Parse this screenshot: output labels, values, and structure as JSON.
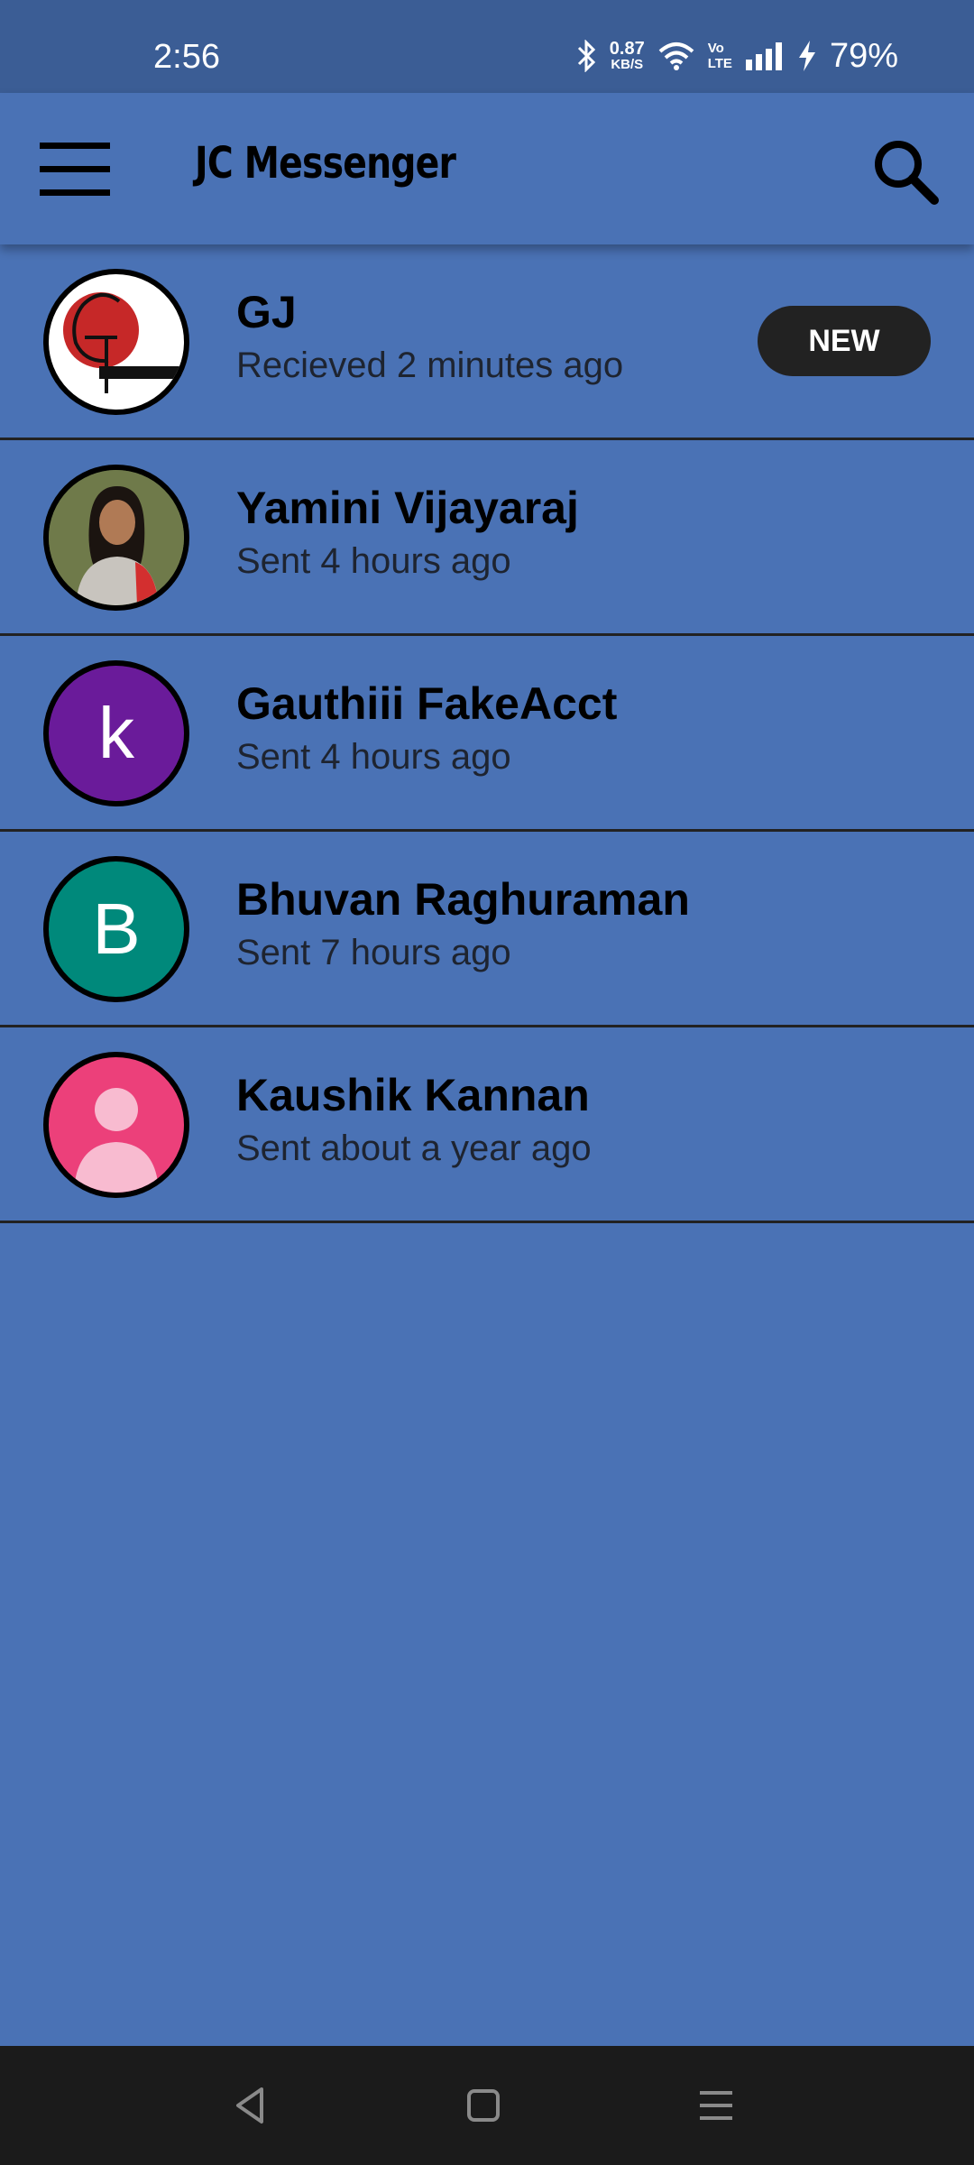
{
  "status_bar": {
    "time": "2:56",
    "data_rate_value": "0.87",
    "data_rate_unit": "KB/S",
    "volte_top": "Vo",
    "volte_bottom": "LTE",
    "battery": "79%",
    "icons": [
      "bluetooth-icon",
      "wifi-icon",
      "signal-icon",
      "charging-icon"
    ]
  },
  "app_bar": {
    "title": "JC Messenger",
    "menu_icon": "hamburger-menu-icon",
    "search_icon": "search-icon"
  },
  "conversations": [
    {
      "name": "GJ",
      "status": "Recieved 2 minutes ago",
      "badge": "NEW",
      "avatar": "logo",
      "avatar_color": "#ffffff"
    },
    {
      "name": "Yamini Vijayaraj",
      "status": "Sent 4 hours ago",
      "avatar": "photo",
      "avatar_color": "#5d6b3f"
    },
    {
      "name": "Gauthiii FakeAcct",
      "status": "Sent 4 hours ago",
      "avatar": "letter",
      "avatar_letter": "k",
      "avatar_color": "#6a1b9a"
    },
    {
      "name": "Bhuvan Raghuraman",
      "status": "Sent 7 hours ago",
      "avatar": "letter",
      "avatar_letter": "B",
      "avatar_color": "#00897b"
    },
    {
      "name": "Kaushik Kannan",
      "status": "Sent about a year ago",
      "avatar": "placeholder",
      "avatar_color": "#ec407a"
    }
  ],
  "nav_bar": {
    "buttons": [
      "back-icon",
      "home-icon",
      "recents-icon"
    ]
  },
  "colors": {
    "background": "#4a72b5",
    "status_bar": "#3b5d95",
    "badge": "#222222",
    "nav_bar": "#1b1b1b"
  }
}
